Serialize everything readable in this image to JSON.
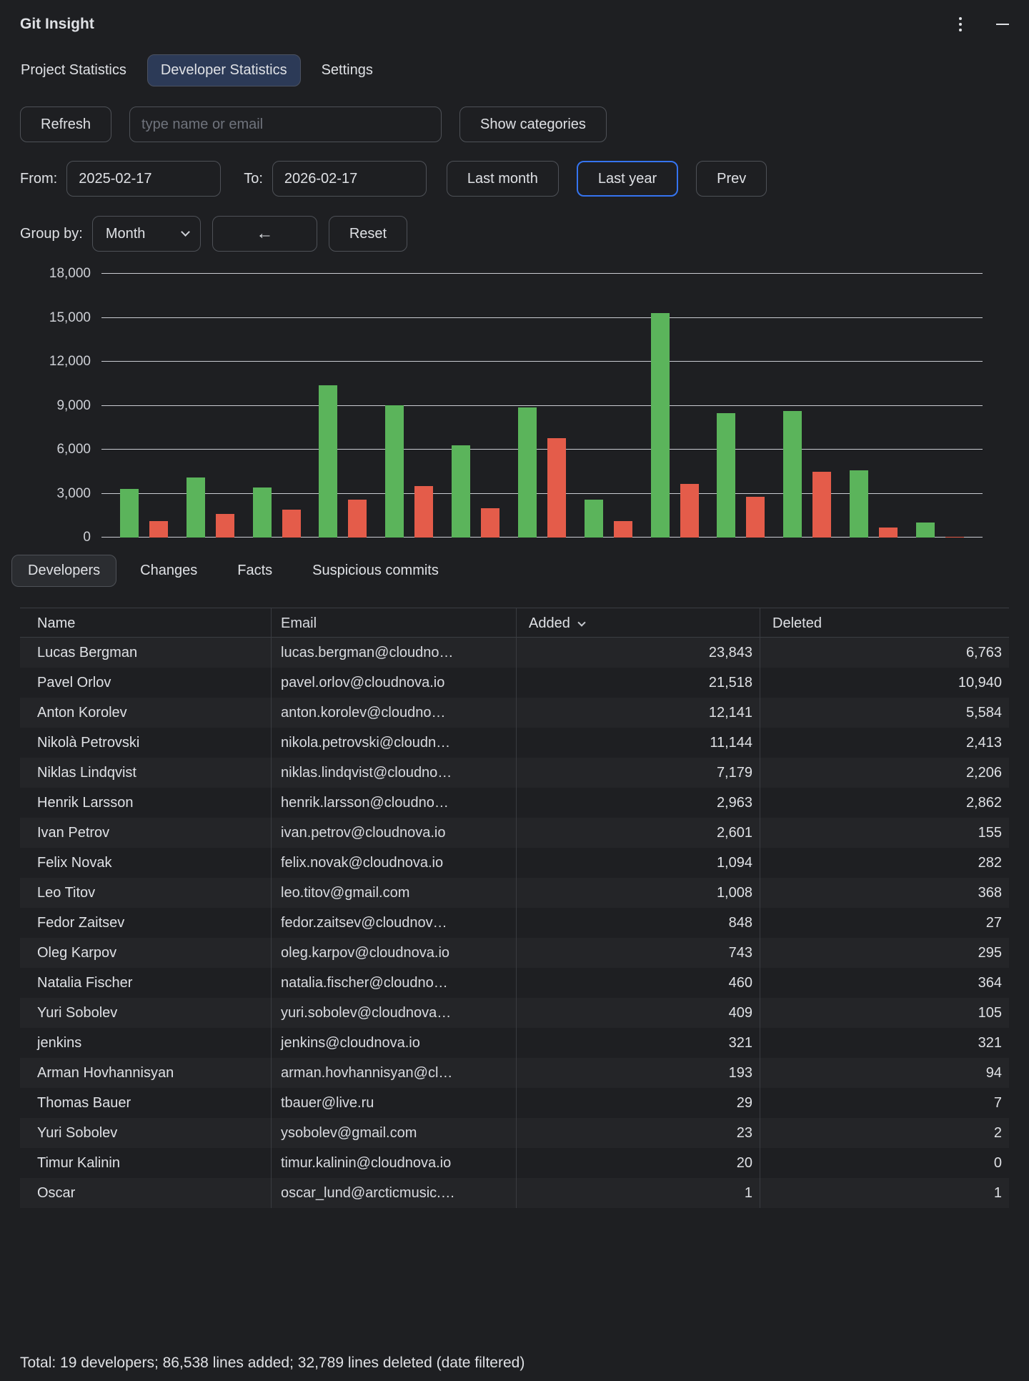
{
  "window": {
    "title": "Git Insight"
  },
  "theme": {
    "accent_blue": "#3574f0",
    "background": "#1e1f22",
    "text": "#dfe1e5"
  },
  "tabs": {
    "items": [
      {
        "label": "Project Statistics",
        "active": false
      },
      {
        "label": "Developer Statistics",
        "active": true
      },
      {
        "label": "Settings",
        "active": false
      }
    ]
  },
  "toolbar": {
    "refresh_label": "Refresh",
    "search_placeholder": "type name or email",
    "show_categories_label": "Show categories"
  },
  "date_filter": {
    "from_label": "From:",
    "from_value": "2025-02-17",
    "to_label": "To:",
    "to_value": "2026-02-17",
    "last_month_label": "Last month",
    "last_year_label": "Last year",
    "prev_label": "Prev"
  },
  "group_by": {
    "label": "Group by:",
    "value": "Month",
    "back_label": "←",
    "reset_label": "Reset"
  },
  "chart_data": {
    "type": "bar",
    "title": "",
    "xlabel": "",
    "ylabel": "",
    "ylim": [
      0,
      18000
    ],
    "yticks": [
      0,
      3000,
      6000,
      9000,
      12000,
      15000,
      18000
    ],
    "ytick_labels": [
      "0",
      "3,000",
      "6,000",
      "9,000",
      "12,000",
      "15,000",
      "18,000"
    ],
    "x_tick_labels_visible": false,
    "grid": true,
    "legend": "none",
    "series": [
      {
        "name": "added",
        "color": "#5bb45b",
        "values": [
          3300,
          4100,
          3400,
          10400,
          9000,
          6300,
          8900,
          2600,
          15300,
          8500,
          8650,
          4600,
          1000
        ]
      },
      {
        "name": "deleted",
        "color": "#e45c4a",
        "values": [
          1100,
          1600,
          1900,
          2600,
          3500,
          2000,
          6800,
          1100,
          3650,
          2800,
          4500,
          700,
          60
        ]
      }
    ]
  },
  "view_tabs": {
    "items": [
      {
        "label": "Developers",
        "active": true
      },
      {
        "label": "Changes",
        "active": false
      },
      {
        "label": "Facts",
        "active": false
      },
      {
        "label": "Suspicious commits",
        "active": false
      }
    ]
  },
  "table": {
    "columns": [
      {
        "label": "Name",
        "sorted": false
      },
      {
        "label": "Email",
        "sorted": false
      },
      {
        "label": "Added",
        "sorted": true
      },
      {
        "label": "Deleted",
        "sorted": false
      }
    ],
    "rows": [
      {
        "name": "Lucas Bergman",
        "email": "lucas.bergman@cloudno…",
        "added": "23,843",
        "deleted": "6,763"
      },
      {
        "name": "Pavel Orlov",
        "email": "pavel.orlov@cloudnova.io",
        "added": "21,518",
        "deleted": "10,940"
      },
      {
        "name": "Anton Korolev",
        "email": "anton.korolev@cloudno…",
        "added": "12,141",
        "deleted": "5,584"
      },
      {
        "name": "Nikolà Petrovski",
        "email": "nikola.petrovski@cloudn…",
        "added": "11,144",
        "deleted": "2,413"
      },
      {
        "name": "Niklas Lindqvist",
        "email": "niklas.lindqvist@cloudno…",
        "added": "7,179",
        "deleted": "2,206"
      },
      {
        "name": "Henrik Larsson",
        "email": "henrik.larsson@cloudno…",
        "added": "2,963",
        "deleted": "2,862"
      },
      {
        "name": "Ivan Petrov",
        "email": "ivan.petrov@cloudnova.io",
        "added": "2,601",
        "deleted": "155"
      },
      {
        "name": "Felix Novak",
        "email": "felix.novak@cloudnova.io",
        "added": "1,094",
        "deleted": "282"
      },
      {
        "name": "Leo Titov",
        "email": "leo.titov@gmail.com",
        "added": "1,008",
        "deleted": "368"
      },
      {
        "name": "Fedor Zaitsev",
        "email": "fedor.zaitsev@cloudnov…",
        "added": "848",
        "deleted": "27"
      },
      {
        "name": "Oleg Karpov",
        "email": "oleg.karpov@cloudnova.io",
        "added": "743",
        "deleted": "295"
      },
      {
        "name": "Natalia Fischer",
        "email": "natalia.fischer@cloudno…",
        "added": "460",
        "deleted": "364"
      },
      {
        "name": "Yuri Sobolev",
        "email": "yuri.sobolev@cloudnova…",
        "added": "409",
        "deleted": "105"
      },
      {
        "name": "jenkins",
        "email": "jenkins@cloudnova.io",
        "added": "321",
        "deleted": "321"
      },
      {
        "name": "Arman Hovhannisyan",
        "email": "arman.hovhannisyan@cl…",
        "added": "193",
        "deleted": "94"
      },
      {
        "name": "Thomas Bauer",
        "email": "tbauer@live.ru",
        "added": "29",
        "deleted": "7"
      },
      {
        "name": "Yuri Sobolev",
        "email": "ysobolev@gmail.com",
        "added": "23",
        "deleted": "2"
      },
      {
        "name": "Timur Kalinin",
        "email": "timur.kalinin@cloudnova.io",
        "added": "20",
        "deleted": "0"
      },
      {
        "name": "Oscar",
        "email": "oscar_lund@arcticmusic.…",
        "added": "1",
        "deleted": "1"
      }
    ]
  },
  "footer": {
    "total": "Total: 19 developers; 86,538 lines added; 32,789 lines deleted (date filtered)"
  }
}
